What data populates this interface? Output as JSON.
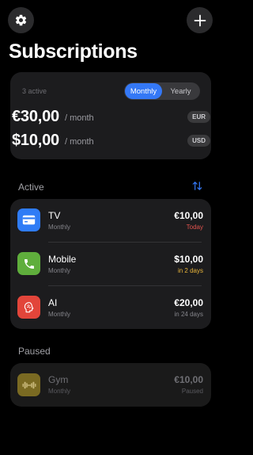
{
  "header": {
    "title": "Subscriptions"
  },
  "summary": {
    "active_count": "3 active",
    "period_options": [
      "Monthly",
      "Yearly"
    ],
    "selected_period": "Monthly",
    "totals": [
      {
        "amount": "€30,00",
        "per": "/ month",
        "currency": "EUR"
      },
      {
        "amount": "$10,00",
        "per": "/ month",
        "currency": "USD"
      }
    ]
  },
  "sections": {
    "active_label": "Active",
    "paused_label": "Paused"
  },
  "active_items": [
    {
      "name": "TV",
      "cycle": "Monthly",
      "price": "€10,00",
      "due": "Today",
      "due_color": "#e0524d",
      "icon": "credit-card-icon",
      "icon_color": "#2f7cf6"
    },
    {
      "name": "Mobile",
      "cycle": "Monthly",
      "price": "$10,00",
      "due": "in 2 days",
      "due_color": "#e8b43a",
      "icon": "phone-icon",
      "icon_color": "#5fae3c"
    },
    {
      "name": "AI",
      "cycle": "Monthly",
      "price": "€20,00",
      "due": "in 24 days",
      "due_color": "#85858b",
      "icon": "brain-icon",
      "icon_color": "#e2453a"
    }
  ],
  "paused_items": [
    {
      "name": "Gym",
      "cycle": "Monthly",
      "price": "€10,00",
      "status": "Paused",
      "icon": "dumbbell-icon",
      "icon_color": "#7a6a22"
    }
  ],
  "colors": {
    "accent": "#3478f6",
    "background": "#000000",
    "card": "#1c1c1e"
  }
}
